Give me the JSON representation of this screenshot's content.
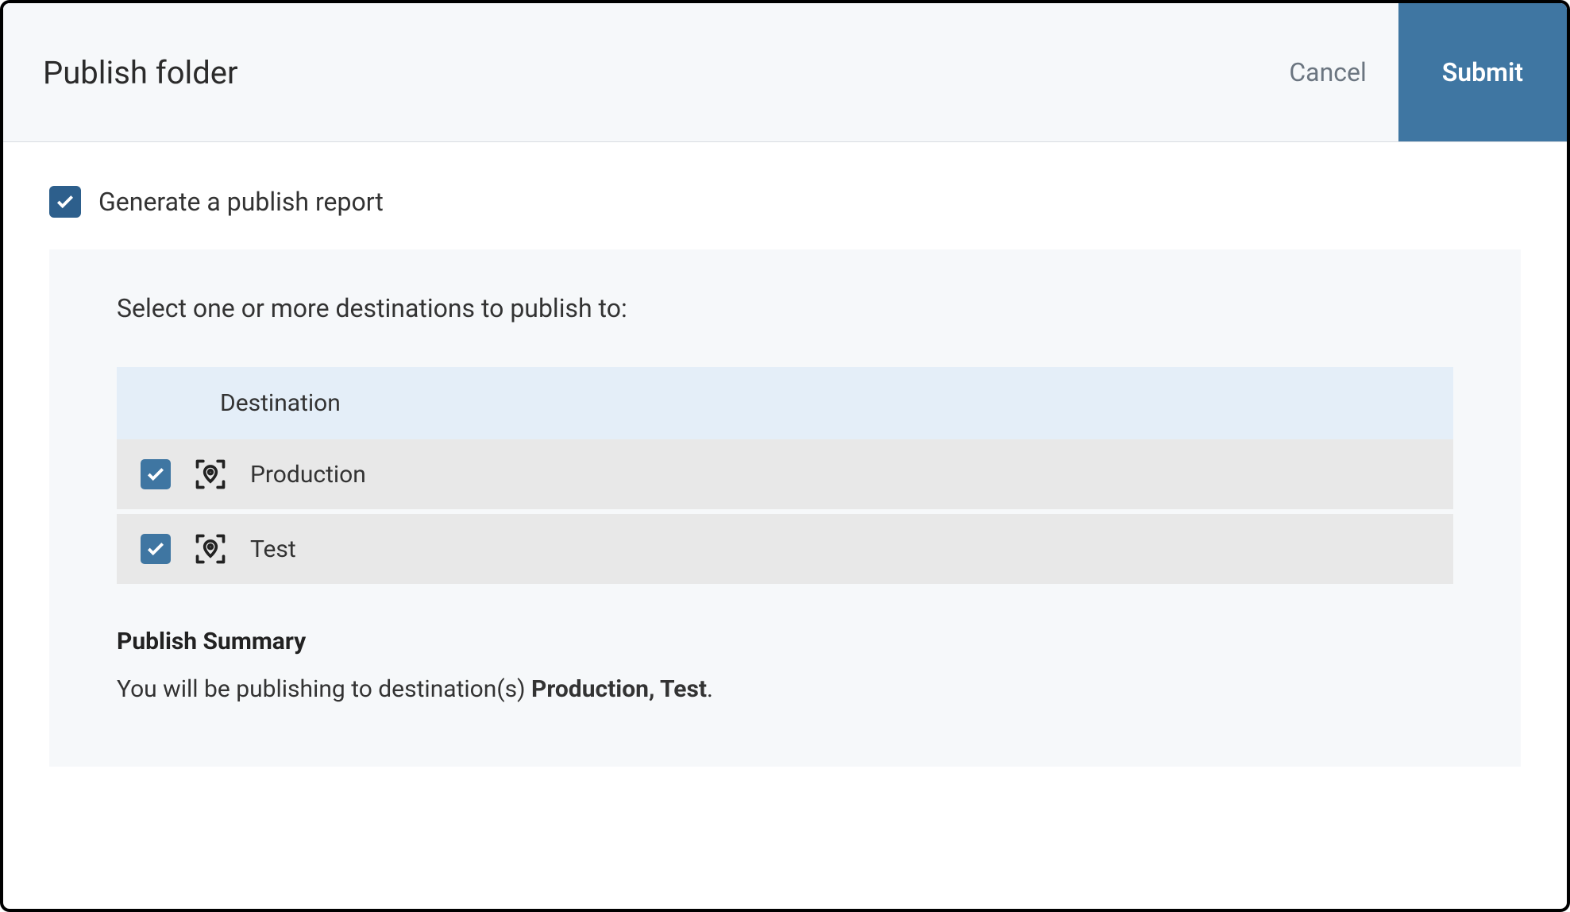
{
  "header": {
    "title": "Publish folder",
    "cancel_label": "Cancel",
    "submit_label": "Submit"
  },
  "options": {
    "generate_report_label": "Generate a publish report",
    "generate_report_checked": true
  },
  "destinations_panel": {
    "prompt": "Select one or more destinations to publish to:",
    "column_header": "Destination",
    "rows": [
      {
        "name": "Production",
        "checked": true
      },
      {
        "name": "Test",
        "checked": true
      }
    ]
  },
  "summary": {
    "heading": "Publish Summary",
    "prefix": "You will be publishing to destination(s) ",
    "destinations": "Production, Test",
    "suffix": "."
  }
}
